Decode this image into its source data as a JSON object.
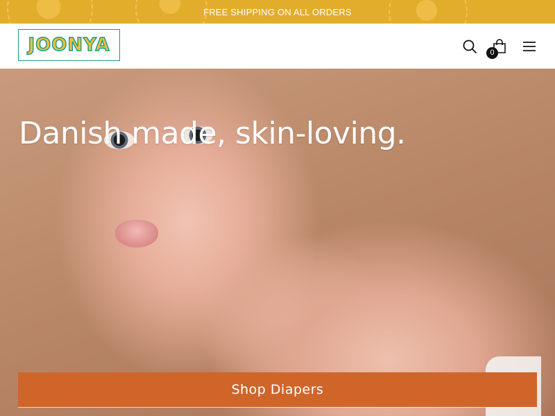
{
  "announcement": {
    "text": "FREE SHIPPING ON ALL ORDERS",
    "background_color": "#e3ad2c"
  },
  "header": {
    "logo_text": "JOONYA",
    "logo_colors": {
      "outline": "#0f9a8f",
      "fill": "#f0c23a"
    },
    "icons": {
      "search": "search-icon",
      "cart": "shopping-bag-icon",
      "menu": "hamburger-menu-icon"
    },
    "cart_count": "0"
  },
  "hero": {
    "title": "Danish made, skin-loving.",
    "cta_label": "Shop Diapers",
    "cta_color": "#d0652a"
  }
}
